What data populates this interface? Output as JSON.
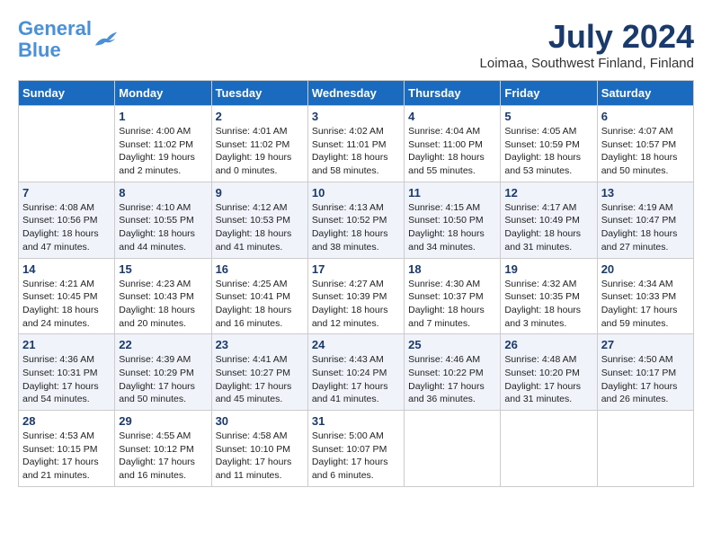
{
  "header": {
    "logo_line1": "General",
    "logo_line2": "Blue",
    "month_title": "July 2024",
    "location": "Loimaa, Southwest Finland, Finland"
  },
  "weekdays": [
    "Sunday",
    "Monday",
    "Tuesday",
    "Wednesday",
    "Thursday",
    "Friday",
    "Saturday"
  ],
  "weeks": [
    [
      {
        "day": "",
        "info": ""
      },
      {
        "day": "1",
        "info": "Sunrise: 4:00 AM\nSunset: 11:02 PM\nDaylight: 19 hours\nand 2 minutes."
      },
      {
        "day": "2",
        "info": "Sunrise: 4:01 AM\nSunset: 11:02 PM\nDaylight: 19 hours\nand 0 minutes."
      },
      {
        "day": "3",
        "info": "Sunrise: 4:02 AM\nSunset: 11:01 PM\nDaylight: 18 hours\nand 58 minutes."
      },
      {
        "day": "4",
        "info": "Sunrise: 4:04 AM\nSunset: 11:00 PM\nDaylight: 18 hours\nand 55 minutes."
      },
      {
        "day": "5",
        "info": "Sunrise: 4:05 AM\nSunset: 10:59 PM\nDaylight: 18 hours\nand 53 minutes."
      },
      {
        "day": "6",
        "info": "Sunrise: 4:07 AM\nSunset: 10:57 PM\nDaylight: 18 hours\nand 50 minutes."
      }
    ],
    [
      {
        "day": "7",
        "info": "Sunrise: 4:08 AM\nSunset: 10:56 PM\nDaylight: 18 hours\nand 47 minutes."
      },
      {
        "day": "8",
        "info": "Sunrise: 4:10 AM\nSunset: 10:55 PM\nDaylight: 18 hours\nand 44 minutes."
      },
      {
        "day": "9",
        "info": "Sunrise: 4:12 AM\nSunset: 10:53 PM\nDaylight: 18 hours\nand 41 minutes."
      },
      {
        "day": "10",
        "info": "Sunrise: 4:13 AM\nSunset: 10:52 PM\nDaylight: 18 hours\nand 38 minutes."
      },
      {
        "day": "11",
        "info": "Sunrise: 4:15 AM\nSunset: 10:50 PM\nDaylight: 18 hours\nand 34 minutes."
      },
      {
        "day": "12",
        "info": "Sunrise: 4:17 AM\nSunset: 10:49 PM\nDaylight: 18 hours\nand 31 minutes."
      },
      {
        "day": "13",
        "info": "Sunrise: 4:19 AM\nSunset: 10:47 PM\nDaylight: 18 hours\nand 27 minutes."
      }
    ],
    [
      {
        "day": "14",
        "info": "Sunrise: 4:21 AM\nSunset: 10:45 PM\nDaylight: 18 hours\nand 24 minutes."
      },
      {
        "day": "15",
        "info": "Sunrise: 4:23 AM\nSunset: 10:43 PM\nDaylight: 18 hours\nand 20 minutes."
      },
      {
        "day": "16",
        "info": "Sunrise: 4:25 AM\nSunset: 10:41 PM\nDaylight: 18 hours\nand 16 minutes."
      },
      {
        "day": "17",
        "info": "Sunrise: 4:27 AM\nSunset: 10:39 PM\nDaylight: 18 hours\nand 12 minutes."
      },
      {
        "day": "18",
        "info": "Sunrise: 4:30 AM\nSunset: 10:37 PM\nDaylight: 18 hours\nand 7 minutes."
      },
      {
        "day": "19",
        "info": "Sunrise: 4:32 AM\nSunset: 10:35 PM\nDaylight: 18 hours\nand 3 minutes."
      },
      {
        "day": "20",
        "info": "Sunrise: 4:34 AM\nSunset: 10:33 PM\nDaylight: 17 hours\nand 59 minutes."
      }
    ],
    [
      {
        "day": "21",
        "info": "Sunrise: 4:36 AM\nSunset: 10:31 PM\nDaylight: 17 hours\nand 54 minutes."
      },
      {
        "day": "22",
        "info": "Sunrise: 4:39 AM\nSunset: 10:29 PM\nDaylight: 17 hours\nand 50 minutes."
      },
      {
        "day": "23",
        "info": "Sunrise: 4:41 AM\nSunset: 10:27 PM\nDaylight: 17 hours\nand 45 minutes."
      },
      {
        "day": "24",
        "info": "Sunrise: 4:43 AM\nSunset: 10:24 PM\nDaylight: 17 hours\nand 41 minutes."
      },
      {
        "day": "25",
        "info": "Sunrise: 4:46 AM\nSunset: 10:22 PM\nDaylight: 17 hours\nand 36 minutes."
      },
      {
        "day": "26",
        "info": "Sunrise: 4:48 AM\nSunset: 10:20 PM\nDaylight: 17 hours\nand 31 minutes."
      },
      {
        "day": "27",
        "info": "Sunrise: 4:50 AM\nSunset: 10:17 PM\nDaylight: 17 hours\nand 26 minutes."
      }
    ],
    [
      {
        "day": "28",
        "info": "Sunrise: 4:53 AM\nSunset: 10:15 PM\nDaylight: 17 hours\nand 21 minutes."
      },
      {
        "day": "29",
        "info": "Sunrise: 4:55 AM\nSunset: 10:12 PM\nDaylight: 17 hours\nand 16 minutes."
      },
      {
        "day": "30",
        "info": "Sunrise: 4:58 AM\nSunset: 10:10 PM\nDaylight: 17 hours\nand 11 minutes."
      },
      {
        "day": "31",
        "info": "Sunrise: 5:00 AM\nSunset: 10:07 PM\nDaylight: 17 hours\nand 6 minutes."
      },
      {
        "day": "",
        "info": ""
      },
      {
        "day": "",
        "info": ""
      },
      {
        "day": "",
        "info": ""
      }
    ]
  ]
}
